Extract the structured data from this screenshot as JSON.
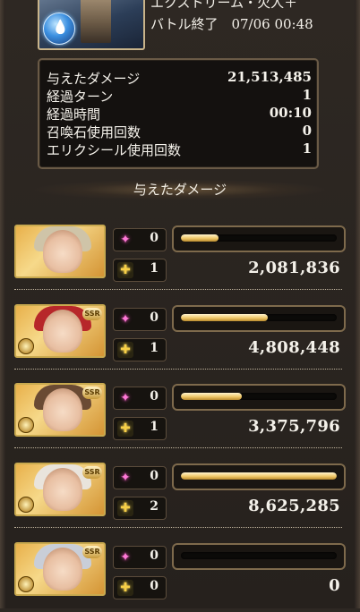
{
  "header": {
    "quest_title": "エクストリーム・火人＋",
    "status_line": "バトル終了　07/06 00:48"
  },
  "stats": {
    "rows": [
      {
        "label": "与えたダメージ",
        "value": "21,513,485"
      },
      {
        "label": "経過ターン",
        "value": "1"
      },
      {
        "label": "経過時間",
        "value": "00:10"
      },
      {
        "label": "召喚石使用回数",
        "value": "0"
      },
      {
        "label": "エリクシール使用回数",
        "value": "1"
      }
    ]
  },
  "section": {
    "title": "与えたダメージ"
  },
  "characters": [
    {
      "ougi": "0",
      "abilities": "1",
      "damage": "2,081,836",
      "bar_fraction": 0.24,
      "hair": "#cfc4a8",
      "ssr": false
    },
    {
      "ougi": "0",
      "abilities": "1",
      "damage": "4,808,448",
      "bar_fraction": 0.56,
      "hair": "#b7272a",
      "ssr": true
    },
    {
      "ougi": "0",
      "abilities": "1",
      "damage": "3,375,796",
      "bar_fraction": 0.39,
      "hair": "#6a4a33",
      "ssr": true
    },
    {
      "ougi": "0",
      "abilities": "2",
      "damage": "8,625,285",
      "bar_fraction": 1.0,
      "hair": "#e9e4dc",
      "ssr": true
    },
    {
      "ougi": "0",
      "abilities": "0",
      "damage": "0",
      "bar_fraction": 0.0,
      "hair": "#c9ced8",
      "ssr": true
    }
  ],
  "labels": {
    "ssr": "SSR"
  },
  "icons": {
    "ougi": "sparkle-icon",
    "ability": "ability-icon",
    "element": "water-element-icon"
  }
}
